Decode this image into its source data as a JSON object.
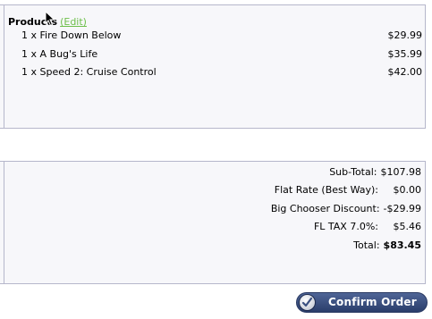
{
  "products": {
    "heading": "Products",
    "edit_label": "(Edit)",
    "items": [
      {
        "qty_name": "1 x Fire Down Below",
        "price": "$29.99"
      },
      {
        "qty_name": "1 x A Bug's Life",
        "price": "$35.99"
      },
      {
        "qty_name": "1 x Speed 2: Cruise Control",
        "price": "$42.00"
      }
    ]
  },
  "totals": {
    "rows": [
      {
        "label": "Sub-Total:",
        "value": "$107.98"
      },
      {
        "label": "Flat Rate (Best Way):",
        "value": "$0.00"
      },
      {
        "label": "Big Chooser Discount:",
        "value": "-$29.99"
      },
      {
        "label": "FL TAX 7.0%:",
        "value": "$5.46"
      },
      {
        "label": "Total:",
        "value": "$83.45"
      }
    ]
  },
  "confirm": {
    "label": "Confirm Order"
  },
  "colors": {
    "panel_bg": "#f7f7fa",
    "panel_border": "#b6b7cb",
    "edit_link": "#6dbf4b",
    "button_bg": "#3b5080"
  },
  "icons": {
    "check": "check-icon",
    "cursor": "mouse-pointer-icon"
  }
}
